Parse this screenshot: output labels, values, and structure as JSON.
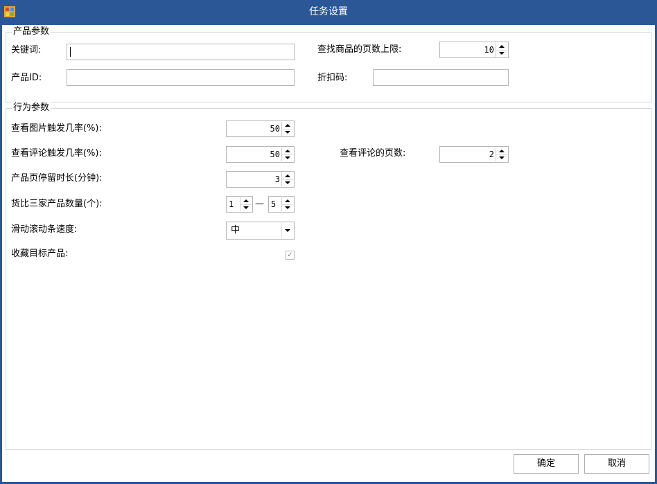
{
  "window": {
    "title": "任务设置",
    "title_bg": "#2b5797",
    "app_icon": "form-app-icon"
  },
  "product_params": {
    "legend": "产品参数",
    "keyword_label": "关键词:",
    "keyword_value": "",
    "product_id_label": "产品ID:",
    "product_id_value": "",
    "max_pages_label": "查找商品的页数上限:",
    "max_pages_value": "10",
    "discount_code_label": "折扣码:",
    "discount_code_value": ""
  },
  "behavior_params": {
    "legend": "行为参数",
    "view_image_label": "查看图片触发几率(%):",
    "view_image_value": "50",
    "view_review_label": "查看评论触发几率(%):",
    "view_review_value": "50",
    "review_pages_label": "查看评论的页数:",
    "review_pages_value": "2",
    "stay_duration_label": "产品页停留时长(分钟):",
    "stay_duration_value": "3",
    "compare_label": "货比三家产品数量(个):",
    "compare_min": "1",
    "compare_sep": "—",
    "compare_max": "5",
    "scroll_speed_label": "滑动滚动条速度:",
    "scroll_speed_value": "中",
    "favorite_label": "收藏目标产品:",
    "favorite_checked": true,
    "favorite_mark": "✓"
  },
  "buttons": {
    "ok": "确定",
    "cancel": "取消"
  }
}
